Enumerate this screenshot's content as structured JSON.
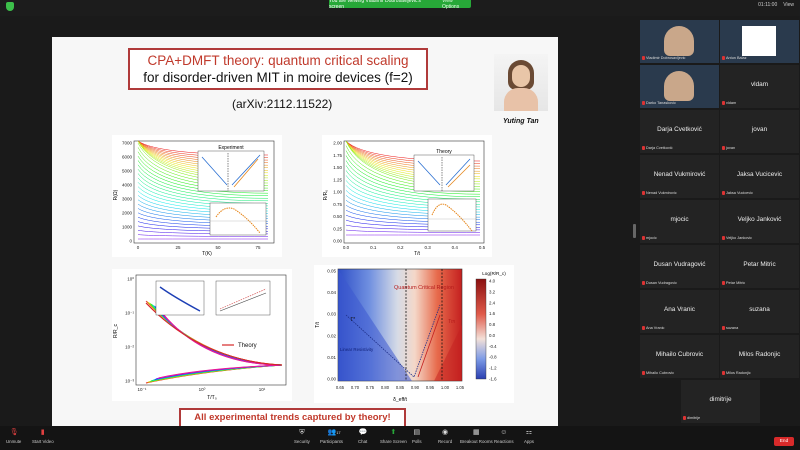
{
  "top": {
    "banner_text": "You are viewing Vladimir Dobrosavljevic's screen",
    "view_options": "View Options",
    "time": "01:11:00",
    "view": "View"
  },
  "slide": {
    "title_line1": "CPA+DMFT theory: quantum critical scaling",
    "title_line2": "for disorder-driven MIT in moire devices (f=2)",
    "arxiv": "(arXiv:2112.11522)",
    "photo_name": "Yuting Tan",
    "bottom_text": "All experimental trends captured by theory!",
    "plot1": {
      "inset_title": "Experiment",
      "xlabel": "T(K)",
      "ylabel": "R(Ω)",
      "yticks": [
        "7000",
        "6000",
        "5000",
        "4000",
        "3000",
        "2000",
        "1000",
        "0"
      ],
      "xticks": [
        "0",
        "25",
        "50",
        "75"
      ]
    },
    "plot2": {
      "inset_title": "Theory",
      "xlabel": "T/t",
      "ylabel": "R/R₀",
      "yticks": [
        "2.00",
        "1.75",
        "1.50",
        "1.25",
        "1.00",
        "0.75",
        "0.50",
        "0.25",
        "0.00"
      ],
      "xticks": [
        "0.0",
        "0.1",
        "0.2",
        "0.3",
        "0.4",
        "0.5"
      ]
    },
    "plot3": {
      "legend": "Theory",
      "xlabel": "T/T₀",
      "ylabel": "R/R_c",
      "yticks": [
        "10⁰",
        "10⁻¹",
        "10⁻²",
        "10⁻³"
      ],
      "xticks": [
        "10⁻¹",
        "10⁰",
        "10¹"
      ]
    },
    "plot4": {
      "title": "Quantum Critical Region",
      "colorbar_title": "Log(R/R_c)",
      "cbar_ticks": [
        "4.0",
        "3.2",
        "2.4",
        "1.6",
        "0.8",
        "0.0",
        "-0.4",
        "-0.8",
        "-1.2",
        "-1.6"
      ],
      "xlabel": "δ_eff/t",
      "ylabel": "T/t",
      "yticks": [
        "0.05",
        "0.04",
        "0.03",
        "0.02",
        "0.01",
        "0.00"
      ],
      "xticks": [
        "0.65",
        "0.70",
        "0.75",
        "0.80",
        "0.85",
        "0.90",
        "0.95",
        "1.00",
        "1.05"
      ],
      "label_linear": "Linear Resistivity",
      "label_ts": "T*",
      "label_tm": "Tm"
    }
  },
  "participants": [
    {
      "tile_name": "",
      "label": "Vladimir Dobrosavljevic",
      "video": true
    },
    {
      "tile_name": "",
      "label": "Antun Balaz",
      "video": true
    },
    {
      "tile_name": "",
      "label": "Darko Tanaskovic",
      "video": true
    },
    {
      "tile_name": "vldam",
      "label": "vldam"
    },
    {
      "tile_name": "Darja Cvetković",
      "label": "Darja Cvetković"
    },
    {
      "tile_name": "jovan",
      "label": "jovan"
    },
    {
      "tile_name": "Nenad Vukmirović",
      "label": "Nenad Vukmirovic"
    },
    {
      "tile_name": "Jaksa Vucicevic",
      "label": "Jaksa Vucicevic"
    },
    {
      "tile_name": "mjocic",
      "label": "mjocic"
    },
    {
      "tile_name": "Veljko Janković",
      "label": "Veljko Jankovic"
    },
    {
      "tile_name": "Dusan Vudragović",
      "label": "Dusan Vudragovic"
    },
    {
      "tile_name": "Petar Mitric",
      "label": "Petar Mitric"
    },
    {
      "tile_name": "Ana Vranic",
      "label": "Ana Vranic"
    },
    {
      "tile_name": "suzana",
      "label": "suzana"
    },
    {
      "tile_name": "Mihailo Cubrovic",
      "label": "Mihailo Cubrovic"
    },
    {
      "tile_name": "Milos Radonjic",
      "label": "Milos Radonjic"
    },
    {
      "tile_name": "dimitrije",
      "label": "dimitrije"
    }
  ],
  "toolbar": {
    "unmute": "Unmute",
    "start_video": "Start Video",
    "security": "Security",
    "participants": "Participants",
    "participants_count": "17",
    "chat": "Chat",
    "share_screen": "Share Screen",
    "polls": "Polls",
    "record": "Record",
    "breakout_rooms": "Breakout Rooms",
    "reactions": "Reactions",
    "apps": "Apps",
    "end": "End"
  },
  "colors": {
    "accent_green": "#27a838",
    "end_red": "#d82a2a",
    "title_red": "#c0392b"
  }
}
